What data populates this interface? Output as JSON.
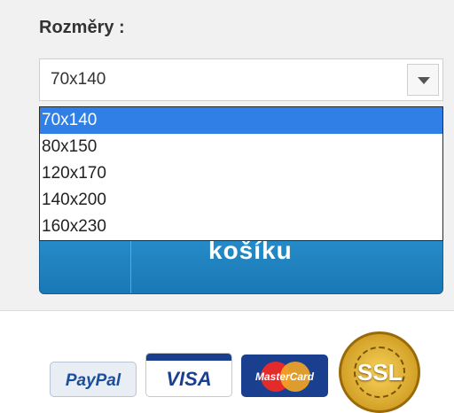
{
  "size_selector": {
    "label": "Rozměry :",
    "selected_value": "70x140",
    "options": [
      "70x140",
      "80x150",
      "120x170",
      "140x200",
      "160x230"
    ],
    "highlighted_option": "70x140"
  },
  "cart_button": {
    "label": "košíku",
    "color": "#1f86c6"
  },
  "payment_logos": {
    "paypal": "PayPal",
    "visa": "VISA",
    "mastercard": "MasterCard",
    "ssl": "SSL"
  }
}
